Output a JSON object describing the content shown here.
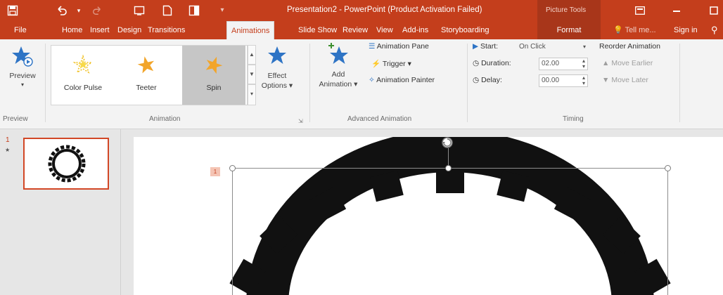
{
  "window": {
    "title": "Presentation2 - PowerPoint (Product Activation Failed)",
    "context_tab_group": "Picture Tools"
  },
  "quick_access": {
    "save_icon": "save-icon",
    "undo_icon": "undo-icon",
    "redo_icon": "redo-icon"
  },
  "tabs": [
    {
      "label": "File"
    },
    {
      "label": "Home"
    },
    {
      "label": "Insert"
    },
    {
      "label": "Design"
    },
    {
      "label": "Transitions"
    },
    {
      "label": "Animations"
    },
    {
      "label": "Slide Show"
    },
    {
      "label": "Review"
    },
    {
      "label": "View"
    },
    {
      "label": "Add-ins"
    },
    {
      "label": "Storyboarding"
    },
    {
      "label": "Format"
    }
  ],
  "tell_me": "Tell me...",
  "sign_in": "Sign in",
  "ribbon": {
    "preview": {
      "button": "Preview",
      "group": "Preview"
    },
    "animation": {
      "group": "Animation",
      "gallery": [
        {
          "label": "Color Pulse"
        },
        {
          "label": "Teeter"
        },
        {
          "label": "Spin",
          "selected": true
        }
      ],
      "effect_options_1": "Effect",
      "effect_options_2": "Options"
    },
    "advanced": {
      "group": "Advanced Animation",
      "add_animation_1": "Add",
      "add_animation_2": "Animation",
      "animation_pane": "Animation Pane",
      "trigger": "Trigger",
      "animation_painter": "Animation Painter"
    },
    "timing": {
      "group": "Timing",
      "start_label": "Start:",
      "start_value": "On Click",
      "duration_label": "Duration:",
      "duration_value": "02.00",
      "delay_label": "Delay:",
      "delay_value": "00.00",
      "reorder_title": "Reorder Animation",
      "move_earlier": "Move Earlier",
      "move_later": "Move Later"
    }
  },
  "slides": [
    {
      "number": "1",
      "has_animation": true
    }
  ],
  "canvas": {
    "animation_tag": "1"
  },
  "colors": {
    "accent": "#c43e1c",
    "ribbon_bg": "#f3f3f3",
    "selected_gallery": "#c6c6c6",
    "gear": "#111111"
  }
}
